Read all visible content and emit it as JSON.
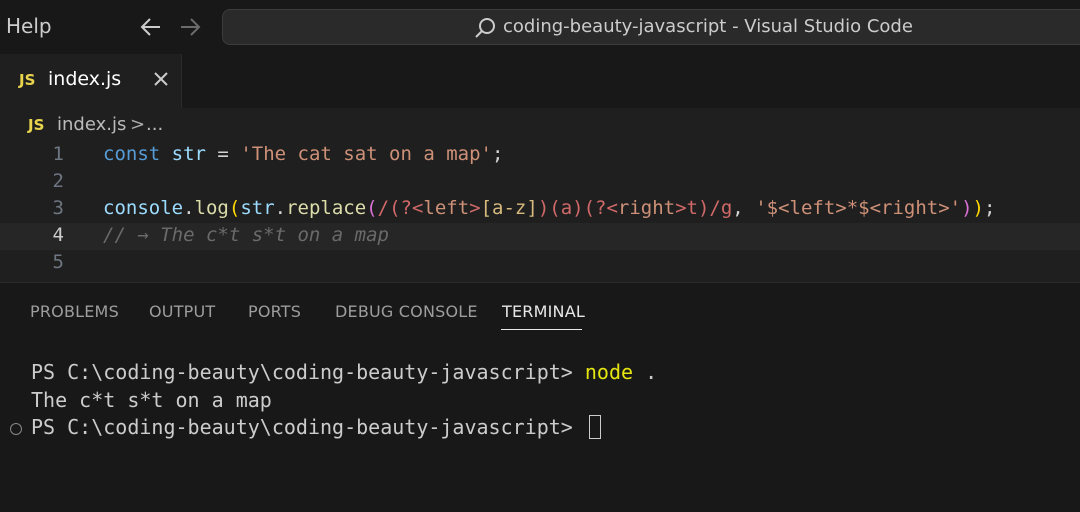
{
  "titlebar": {
    "menu_help": "Help",
    "command_center_text": "coding-beauty-javascript - Visual Studio Code"
  },
  "tabs": [
    {
      "badge": "JS",
      "label": "index.js"
    }
  ],
  "breadcrumb": {
    "badge": "JS",
    "file": "index.js",
    "separator": ">",
    "more": "..."
  },
  "editor": {
    "line_numbers": [
      "1",
      "2",
      "3",
      "4",
      "5"
    ],
    "current_line": 4,
    "lines": [
      {
        "kw": "const",
        "var": "str",
        "op": " = ",
        "str": "'The cat sat on a map'",
        "end": ";"
      },
      {},
      {
        "obj": "console",
        "dot1": ".",
        "fn1": "log",
        "p1": "(",
        "arg": "str",
        "dot2": ".",
        "fn2": "replace",
        "p2": "(",
        "rx1": "/(?<",
        "rx_g1": "left",
        "rx2": ">",
        "rx_c": "[a-z]",
        "rx3": ")(a)(?<",
        "rx_g2": "right",
        "rx4": ">t)/g",
        "comma": ", ",
        "str": "'$<left>*$<right>'",
        "p3": ")",
        "p4": ")",
        "end": ";"
      },
      {
        "comment": "// → The c*t s*t on a map"
      },
      {}
    ]
  },
  "panel": {
    "tabs": [
      "PROBLEMS",
      "OUTPUT",
      "PORTS",
      "DEBUG CONSOLE",
      "TERMINAL"
    ],
    "active_tab": "TERMINAL",
    "terminal": {
      "prompt1": "PS C:\\coding-beauty\\coding-beauty-javascript> ",
      "command": "node",
      "command_arg": " .",
      "output": "The c*t s*t on a map",
      "prompt2": "PS C:\\coding-beauty\\coding-beauty-javascript> "
    }
  },
  "colors": {
    "js_badge": "#e8d44d",
    "terminal_command": "#e5e510",
    "keyword": "#569cd6",
    "string": "#ce9178"
  }
}
